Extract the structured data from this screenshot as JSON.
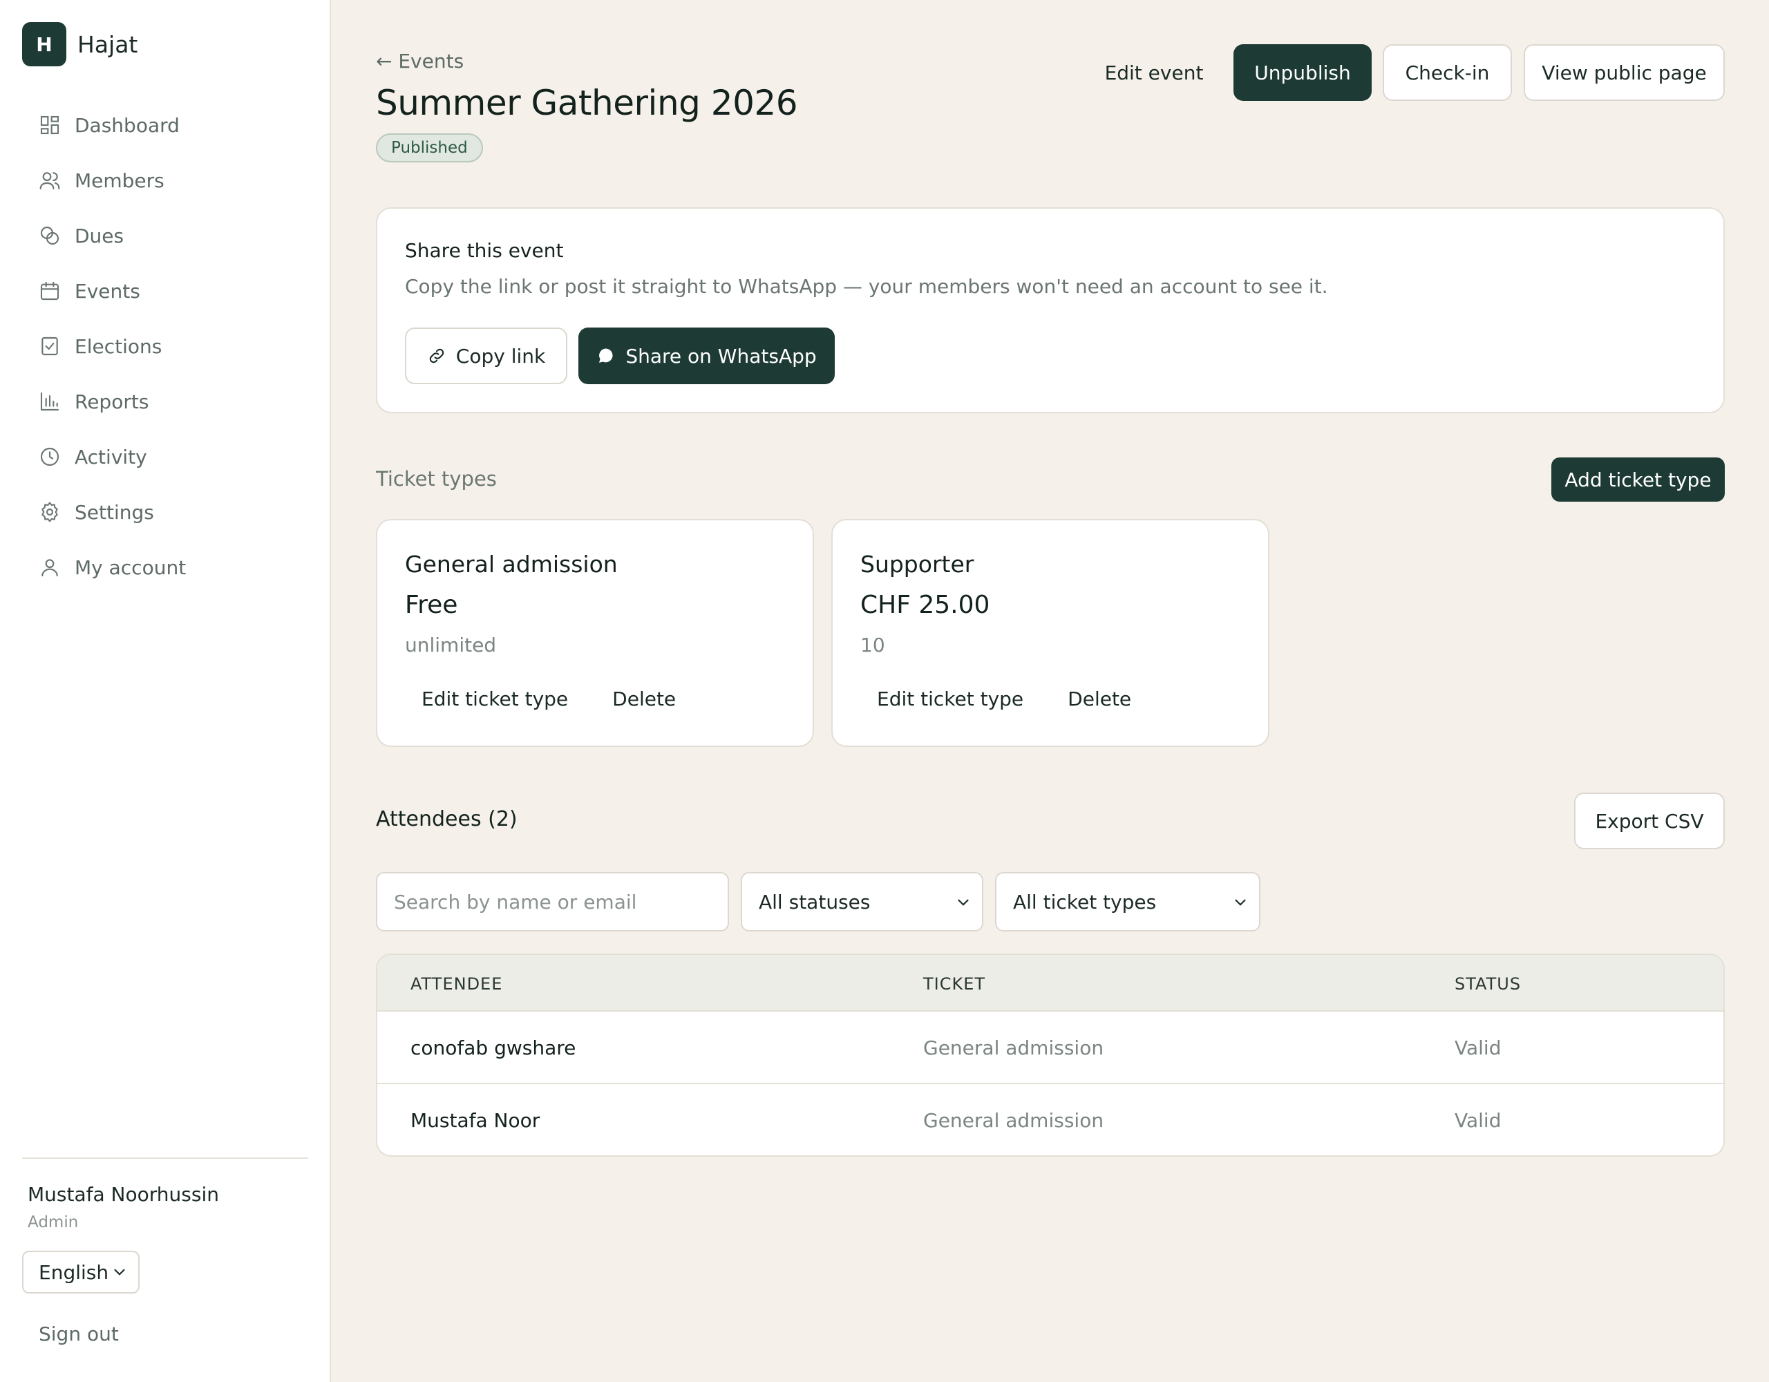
{
  "brand": {
    "logo_letter": "H",
    "name": "Hajat"
  },
  "sidebar": {
    "items": [
      {
        "label": "Dashboard",
        "icon": "dashboard-icon"
      },
      {
        "label": "Members",
        "icon": "members-icon"
      },
      {
        "label": "Dues",
        "icon": "dues-icon"
      },
      {
        "label": "Events",
        "icon": "calendar-icon"
      },
      {
        "label": "Elections",
        "icon": "ballot-icon"
      },
      {
        "label": "Reports",
        "icon": "bar-chart-icon"
      },
      {
        "label": "Activity",
        "icon": "clock-icon"
      },
      {
        "label": "Settings",
        "icon": "gear-icon"
      },
      {
        "label": "My account",
        "icon": "user-icon"
      }
    ],
    "user": {
      "name": "Mustafa Noorhussin",
      "role": "Admin"
    },
    "language": "English",
    "sign_out": "Sign out"
  },
  "header": {
    "back_label": "← Events",
    "title": "Summer Gathering 2026",
    "status": "Published",
    "actions": {
      "edit": "Edit event",
      "unpublish": "Unpublish",
      "checkin": "Check-in",
      "view_public": "View public page"
    }
  },
  "share": {
    "title": "Share this event",
    "description": "Copy the link or post it straight to WhatsApp — your members won't need an account to see it.",
    "copy_label": "Copy link",
    "whatsapp_label": "Share on WhatsApp"
  },
  "tickets": {
    "section_label": "Ticket types",
    "add_label": "Add ticket type",
    "items": [
      {
        "name": "General admission",
        "price": "Free",
        "quantity": "unlimited",
        "edit": "Edit ticket type",
        "delete": "Delete"
      },
      {
        "name": "Supporter",
        "price": "CHF 25.00",
        "quantity": "10",
        "edit": "Edit ticket type",
        "delete": "Delete"
      }
    ]
  },
  "attendees": {
    "title": "Attendees (2)",
    "export_label": "Export CSV",
    "search_placeholder": "Search by name or email",
    "status_filter": "All statuses",
    "ticket_filter": "All ticket types",
    "columns": [
      "ATTENDEE",
      "TICKET",
      "STATUS"
    ],
    "rows": [
      {
        "name": "conofab gwshare",
        "ticket": "General admission",
        "status": "Valid"
      },
      {
        "name": "Mustafa Noor",
        "ticket": "General admission",
        "status": "Valid"
      }
    ]
  },
  "colors": {
    "primary": "#1d3b34",
    "background": "#f5f1ea",
    "surface": "#ffffff",
    "badge_bg": "#e1e8e1",
    "badge_text": "#2e5a45"
  }
}
